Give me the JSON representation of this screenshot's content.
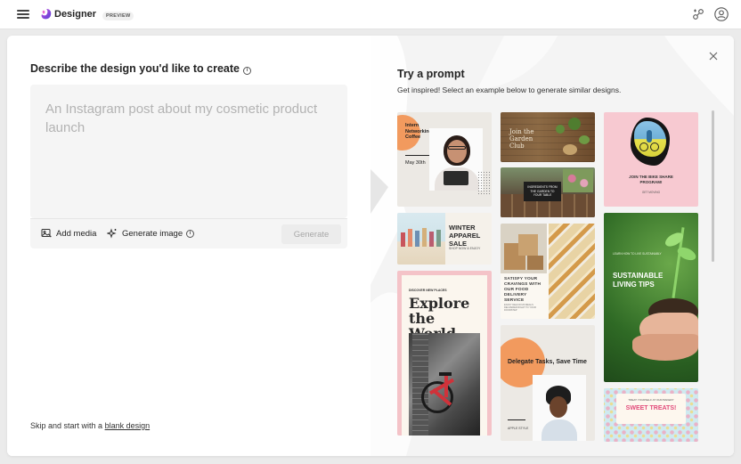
{
  "app": {
    "brand": "Designer",
    "badge": "PREVIEW"
  },
  "icons": {
    "menu": "hamburger-icon",
    "logo": "designer-logo",
    "share": "share-icon",
    "account": "account-icon",
    "close": "close-icon"
  },
  "describe": {
    "title": "Describe the design you'd like to create",
    "placeholder": "An Instagram post about my cosmetic product launch",
    "add_media": "Add media",
    "generate_image": "Generate image",
    "generate_button": "Generate",
    "skip_prefix": "Skip and start with a",
    "skip_link": "blank design"
  },
  "prompts": {
    "title": "Try a prompt",
    "subtitle": "Get inspired! Select an example below to generate similar designs.",
    "tiles": {
      "networking": {
        "title": "Intern Networking Coffee",
        "date": "May 30th"
      },
      "garden": {
        "title": "Join the Garden Club"
      },
      "bike": {
        "title": "JOIN THE BIKE SHARE PROGRAM!",
        "sub": "GET MOVING"
      },
      "restaurant": {
        "title": "INGREDIENTS FROM THE GARDEN TO YOUR TABLE"
      },
      "winter": {
        "title": "WINTER APPAREL SALE",
        "sub": "SHOP NOW & ENJOY"
      },
      "food": {
        "title": "SATISFY YOUR CRAVINGS WITH OUR FOOD DELIVERY SERVICE",
        "sub": "ENJOY DELICIOUS MEALS DELIVERED RIGHT TO YOUR DOORSTEP"
      },
      "sustainable": {
        "kicker": "LEARN HOW TO LIVE SUSTAINABLY",
        "title": "SUSTAINABLE LIVING TIPS"
      },
      "explore": {
        "kicker": "DISCOVER NEW PLACES",
        "title": "Explore the World"
      },
      "delegate": {
        "title": "Delegate Tasks, Save Time",
        "sub": "APPLE STYLE"
      },
      "sweet": {
        "kicker": "TREAT YOURSELF AT OUR BAKERY",
        "title": "SWEET TREATS!"
      }
    }
  },
  "colors": {
    "accent_orange": "#f29a5e",
    "bike_pink": "#f7c9d1",
    "sustainable_green": "#3f7d2e",
    "explore_pink": "#f4c3c8",
    "bike_red": "#d0323a"
  }
}
